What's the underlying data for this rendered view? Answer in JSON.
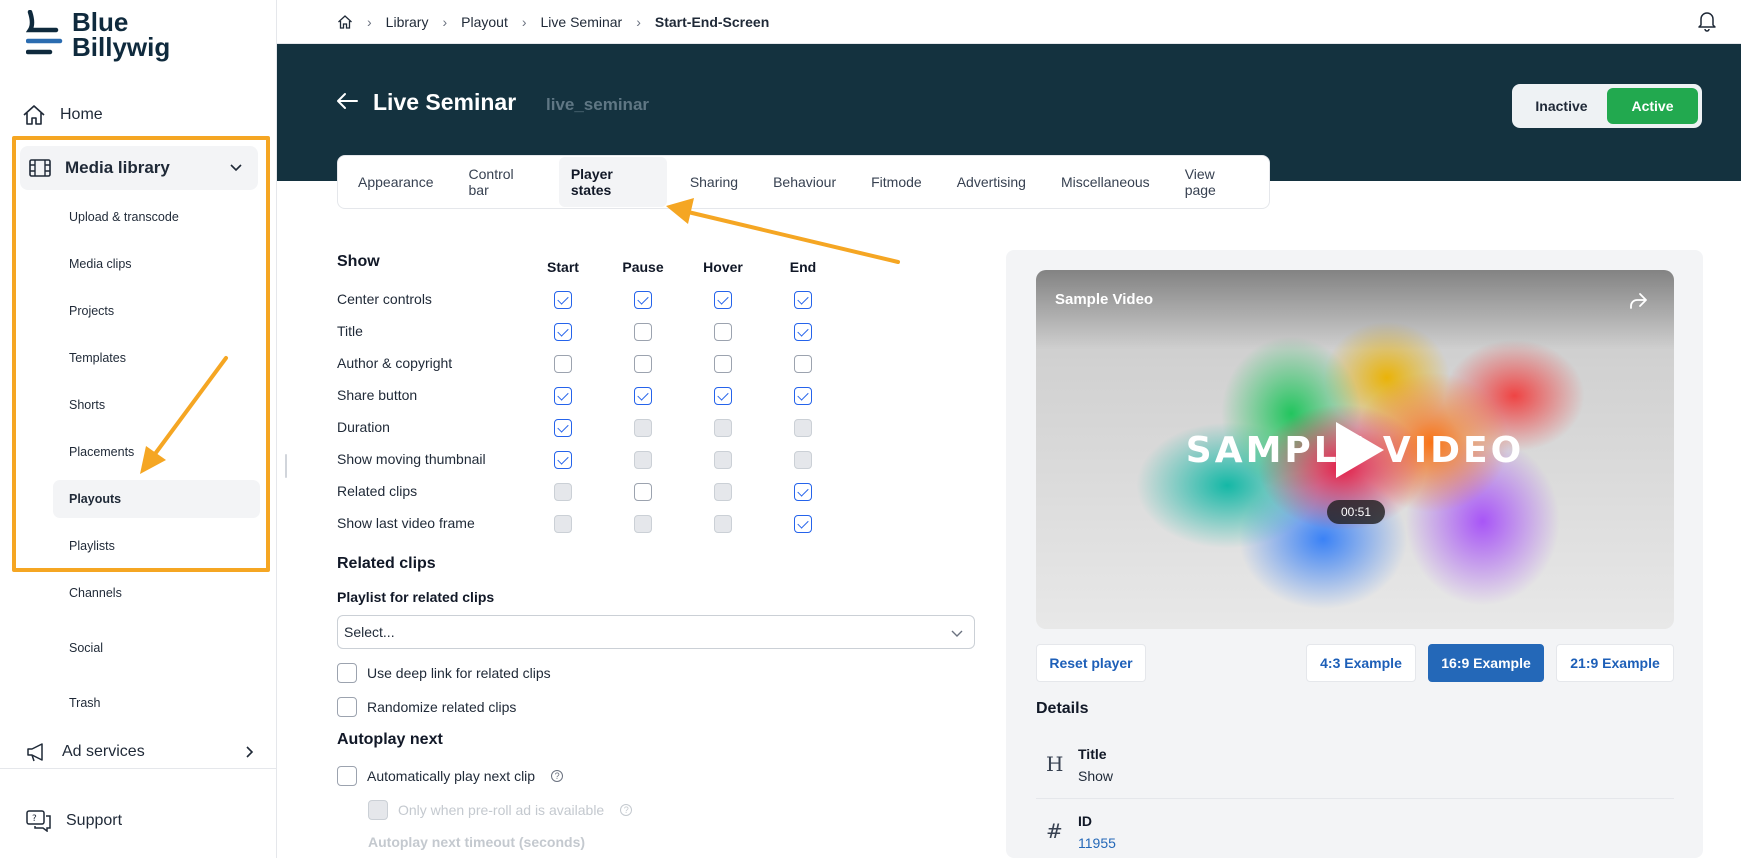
{
  "brand": {
    "line1": "Blue",
    "line2": "Billywig",
    "color": "#0f2a3d"
  },
  "sidebar": {
    "home": "Home",
    "media_library": "Media library",
    "sub_items": [
      "Upload & transcode",
      "Media clips",
      "Projects",
      "Templates",
      "Shorts",
      "Placements",
      "Playouts",
      "Playlists",
      "Channels",
      "Social",
      "Trash"
    ],
    "active_sub": "Playouts",
    "ad_services": "Ad services",
    "support": "Support"
  },
  "breadcrumb": {
    "items": [
      "Library",
      "Playout",
      "Live Seminar"
    ],
    "current": "Start-End-Screen"
  },
  "header": {
    "title": "Live Seminar",
    "slug": "live_seminar",
    "inactive": "Inactive",
    "active": "Active",
    "active_color": "#22a94f"
  },
  "tabs": [
    "Appearance",
    "Control bar",
    "Player states",
    "Sharing",
    "Behaviour",
    "Fitmode",
    "Advertising",
    "Miscellaneous",
    "View page"
  ],
  "active_tab": "Player states",
  "player_states": {
    "section": "Show",
    "columns": [
      "Start",
      "Pause",
      "Hover",
      "End"
    ],
    "rows": [
      {
        "label": "Center controls",
        "states": [
          "checked",
          "checked",
          "checked",
          "checked"
        ]
      },
      {
        "label": "Title",
        "states": [
          "checked",
          "unchecked",
          "unchecked",
          "checked"
        ]
      },
      {
        "label": "Author & copyright",
        "states": [
          "unchecked",
          "unchecked",
          "unchecked",
          "unchecked"
        ]
      },
      {
        "label": "Share button",
        "states": [
          "checked",
          "checked",
          "checked",
          "checked"
        ]
      },
      {
        "label": "Duration",
        "states": [
          "checked",
          "disabled",
          "disabled",
          "disabled"
        ]
      },
      {
        "label": "Show moving thumbnail",
        "states": [
          "checked",
          "disabled",
          "disabled",
          "disabled"
        ]
      },
      {
        "label": "Related clips",
        "states": [
          "disabled",
          "unchecked",
          "disabled",
          "checked"
        ]
      },
      {
        "label": "Show last video frame",
        "states": [
          "disabled",
          "disabled",
          "disabled",
          "checked"
        ]
      }
    ]
  },
  "related": {
    "section": "Related clips",
    "playlist_label": "Playlist for related clips",
    "playlist_placeholder": "Select...",
    "deep_link": "Use deep link for related clips",
    "randomize": "Randomize related clips"
  },
  "autoplay": {
    "section": "Autoplay next",
    "auto_play": "Automatically play next clip",
    "preroll_only": "Only when pre-roll ad is available",
    "timeout_label": "Autoplay next timeout (seconds)"
  },
  "preview": {
    "video_title": "Sample Video",
    "video_word": "SAMPLE VIDEO",
    "duration": "00:51",
    "reset": "Reset player",
    "ex43": "4:3 Example",
    "ex169": "16:9 Example",
    "ex219": "21:9 Example"
  },
  "details": {
    "title": "Details",
    "rows": [
      {
        "icon": "H",
        "label": "Title",
        "value": "Show"
      },
      {
        "icon": "#",
        "label": "ID",
        "value": "11955"
      }
    ]
  },
  "annotation_color": "#f5a623"
}
